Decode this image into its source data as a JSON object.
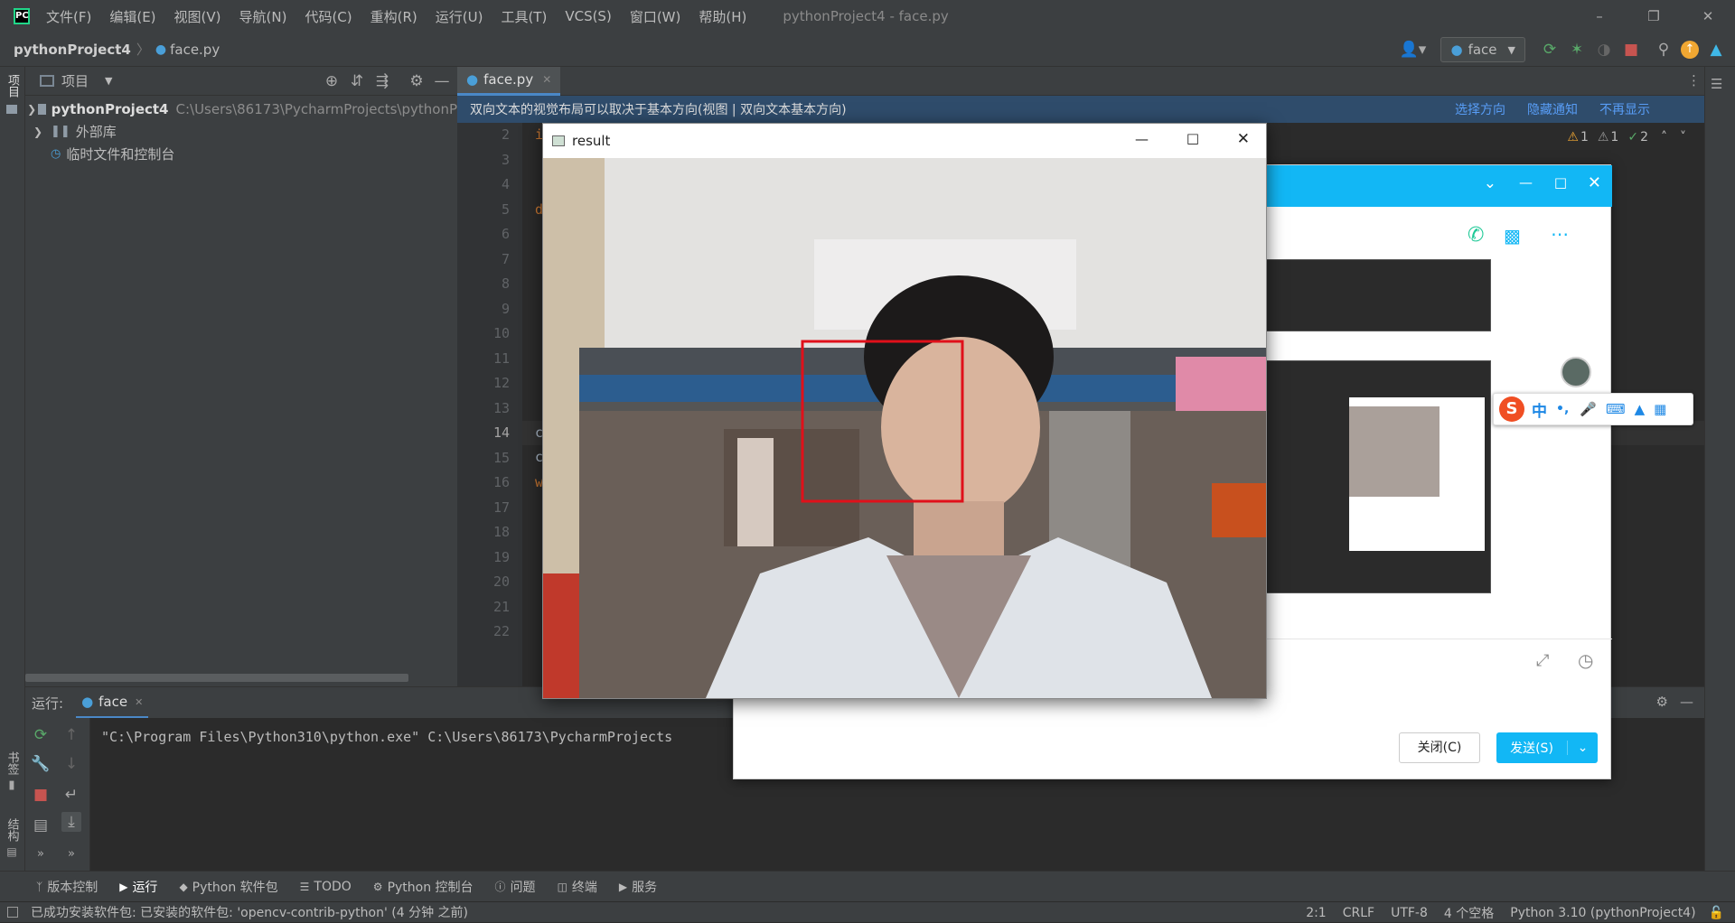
{
  "menubar": {
    "items": [
      "文件(F)",
      "编辑(E)",
      "视图(V)",
      "导航(N)",
      "代码(C)",
      "重构(R)",
      "运行(U)",
      "工具(T)",
      "VCS(S)",
      "窗口(W)",
      "帮助(H)"
    ],
    "window_title": "pythonProject4 - face.py"
  },
  "navbar": {
    "project": "pythonProject4",
    "file": "face.py",
    "run_config": "face"
  },
  "project_panel": {
    "title": "项目",
    "items": [
      {
        "label": "pythonProject4",
        "path": "C:\\Users\\86173\\PycharmProjects\\pythonP"
      },
      {
        "label": "外部库"
      },
      {
        "label": "临时文件和控制台"
      }
    ]
  },
  "left_strip": {
    "project": "项目",
    "bookmarks": "书签",
    "structure": "结构"
  },
  "editor": {
    "tab": "face.py",
    "notice": "双向文本的视觉布局可以取决于基本方向(视图 | 双向文本基本方向)",
    "notice_actions": [
      "选择方向",
      "隐藏通知",
      "不再显示"
    ],
    "inspections": {
      "warn1": "1",
      "warn2": "1",
      "ok": "2"
    },
    "line_numbers": [
      "2",
      "3",
      "4",
      "5",
      "6",
      "7",
      "8",
      "9",
      "10",
      "11",
      "12",
      "13",
      "14",
      "15",
      "16",
      "17",
      "18",
      "19",
      "20",
      "21",
      "22"
    ],
    "code_fragments": {
      "l2": "i",
      "l5": "de",
      "l14": "ca",
      "l15": "cv",
      "l16": "wh"
    }
  },
  "run_panel": {
    "label": "运行:",
    "tab": "face",
    "console": "\"C:\\Program Files\\Python310\\python.exe\" C:\\Users\\86173\\PycharmProjects"
  },
  "bottom_tabs": [
    "版本控制",
    "运行",
    "Python 软件包",
    "TODO",
    "Python 控制台",
    "问题",
    "终端",
    "服务"
  ],
  "status": {
    "message": "已成功安装软件包: 已安装的软件包: 'opencv-contrib-python' (4 分钟 之前)",
    "position": "2:1",
    "line_sep": "CRLF",
    "encoding": "UTF-8",
    "indent": "4 个空格",
    "interpreter": "Python 3.10 (pythonProject4)"
  },
  "result_window": {
    "title": "result"
  },
  "chat_window": {
    "close_label": "关闭(C)",
    "send_label": "发送(S)"
  },
  "ime": {
    "mode": "中",
    "punct": "•,"
  },
  "colors": {
    "accent": "#12b7f5",
    "face_box": "#e0101a",
    "notice_bg": "#2f4c6b"
  }
}
